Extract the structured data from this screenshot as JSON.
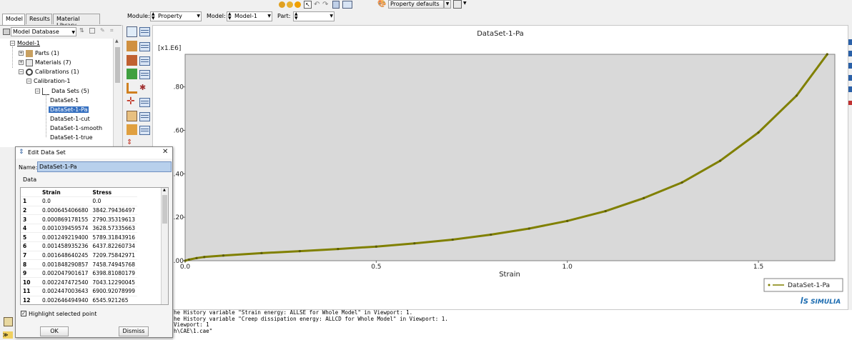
{
  "toolbar": {
    "module_label": "Module:",
    "module_value": "Property",
    "model_label": "Model:",
    "model_value": "Model-1",
    "part_label": "Part:",
    "part_value": "",
    "property_defaults": "Property defaults"
  },
  "tabs": [
    "Model",
    "Results",
    "Material Library"
  ],
  "model_db": {
    "value": "Model Database"
  },
  "tree": {
    "model": "Model-1",
    "parts": "Parts (1)",
    "materials": "Materials (7)",
    "calibrations": "Calibrations (1)",
    "calibration": "Calibration-1",
    "datasets": "Data Sets (5)",
    "items": [
      "DataSet-1",
      "DataSet-1-Pa",
      "DataSet-1-cut",
      "DataSet-1-smooth",
      "DataSet-1-true"
    ]
  },
  "dialog": {
    "title": "Edit Data Set",
    "name_label": "Name:",
    "name_value": "DataSet-1-Pa",
    "group_label": "Data",
    "col_strain": "Strain",
    "col_stress": "Stress",
    "rows": [
      [
        "1",
        "0.0",
        "0.0"
      ],
      [
        "2",
        "0.000645406680",
        "3842.79436497"
      ],
      [
        "3",
        "0.000869178155",
        "2790.35319613"
      ],
      [
        "4",
        "0.001039459574",
        "3628.57335663"
      ],
      [
        "5",
        "0.001249219400",
        "5789.31843916"
      ],
      [
        "6",
        "0.001458935236",
        "6437.82260734"
      ],
      [
        "7",
        "0.001648640245",
        "7209.75842971"
      ],
      [
        "8",
        "0.001848290857",
        "7458.74945768"
      ],
      [
        "9",
        "0.002047901617",
        "6398.81080179"
      ],
      [
        "10",
        "0.002247472540",
        "7043.12290045"
      ],
      [
        "11",
        "0.002447003643",
        "6900.92078999"
      ],
      [
        "12",
        "0.002646494940",
        "6545.921265"
      ]
    ],
    "highlight_label": "Highlight selected point",
    "ok_label": "OK",
    "dismiss_label": "Dismiss"
  },
  "viewport": {
    "brand": "SIMULIA"
  },
  "chart_data": {
    "type": "line",
    "title": "DataSet-1-Pa",
    "xlabel": "Strain",
    "ylabel": "",
    "yscale_label": "[x1.E6]",
    "xlim": [
      0.0,
      1.7
    ],
    "ylim": [
      0.0,
      0.95
    ],
    "xticks": [
      "0.0",
      "0.5",
      "1.0",
      "1.5"
    ],
    "yticks": [
      ".00",
      ".20",
      ".40",
      ".60",
      ".80"
    ],
    "ytick_values": [
      0.0,
      0.2,
      0.4,
      0.6,
      0.8
    ],
    "xtick_values": [
      0.0,
      0.5,
      1.0,
      1.5
    ],
    "legend_position": "bottom-right",
    "color": "#808000",
    "series": [
      {
        "name": "DataSet-1-Pa",
        "x": [
          0.0,
          0.01,
          0.03,
          0.05,
          0.1,
          0.2,
          0.3,
          0.4,
          0.5,
          0.6,
          0.7,
          0.8,
          0.9,
          1.0,
          1.1,
          1.2,
          1.3,
          1.4,
          1.5,
          1.6,
          1.68
        ],
        "y": [
          0.0,
          0.005,
          0.012,
          0.017,
          0.024,
          0.035,
          0.044,
          0.054,
          0.065,
          0.08,
          0.097,
          0.12,
          0.148,
          0.183,
          0.228,
          0.288,
          0.36,
          0.46,
          0.59,
          0.76,
          0.95
        ]
      }
    ]
  },
  "messages": [
    "he History variable \"Strain energy: ALLSE for Whole Model\" in Viewport: 1.",
    "he History variable \"Creep dissipation energy: ALLCD for Whole Model\" in Viewport: 1.",
    "Viewport: 1",
    "h\\CAE\\1.cae\""
  ]
}
